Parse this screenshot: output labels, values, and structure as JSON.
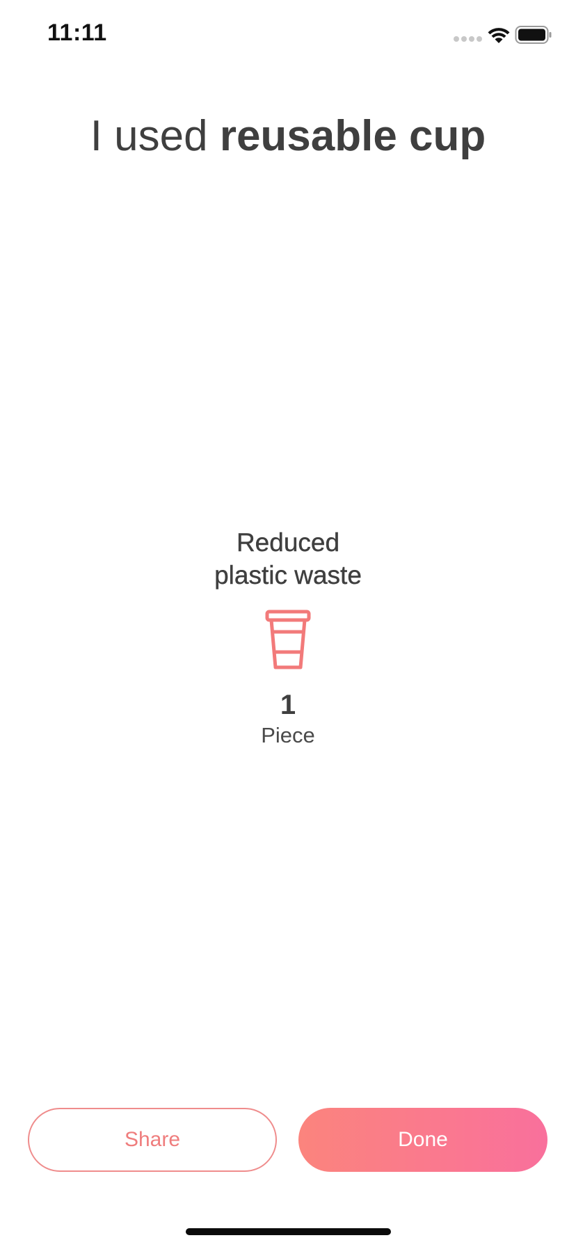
{
  "status_bar": {
    "time": "11:11"
  },
  "title": {
    "prefix": "I used ",
    "emphasis": "reusable cup"
  },
  "stat": {
    "label_line1": "Reduced",
    "label_line2": "plastic waste",
    "icon": "cup-icon",
    "value": "1",
    "unit": "Piece"
  },
  "actions": {
    "share_label": "Share",
    "done_label": "Done"
  },
  "colors": {
    "accent": "#ef7d7d",
    "gradient_start": "#fb847d",
    "gradient_end": "#f9709c",
    "text": "#3f3f3f"
  }
}
